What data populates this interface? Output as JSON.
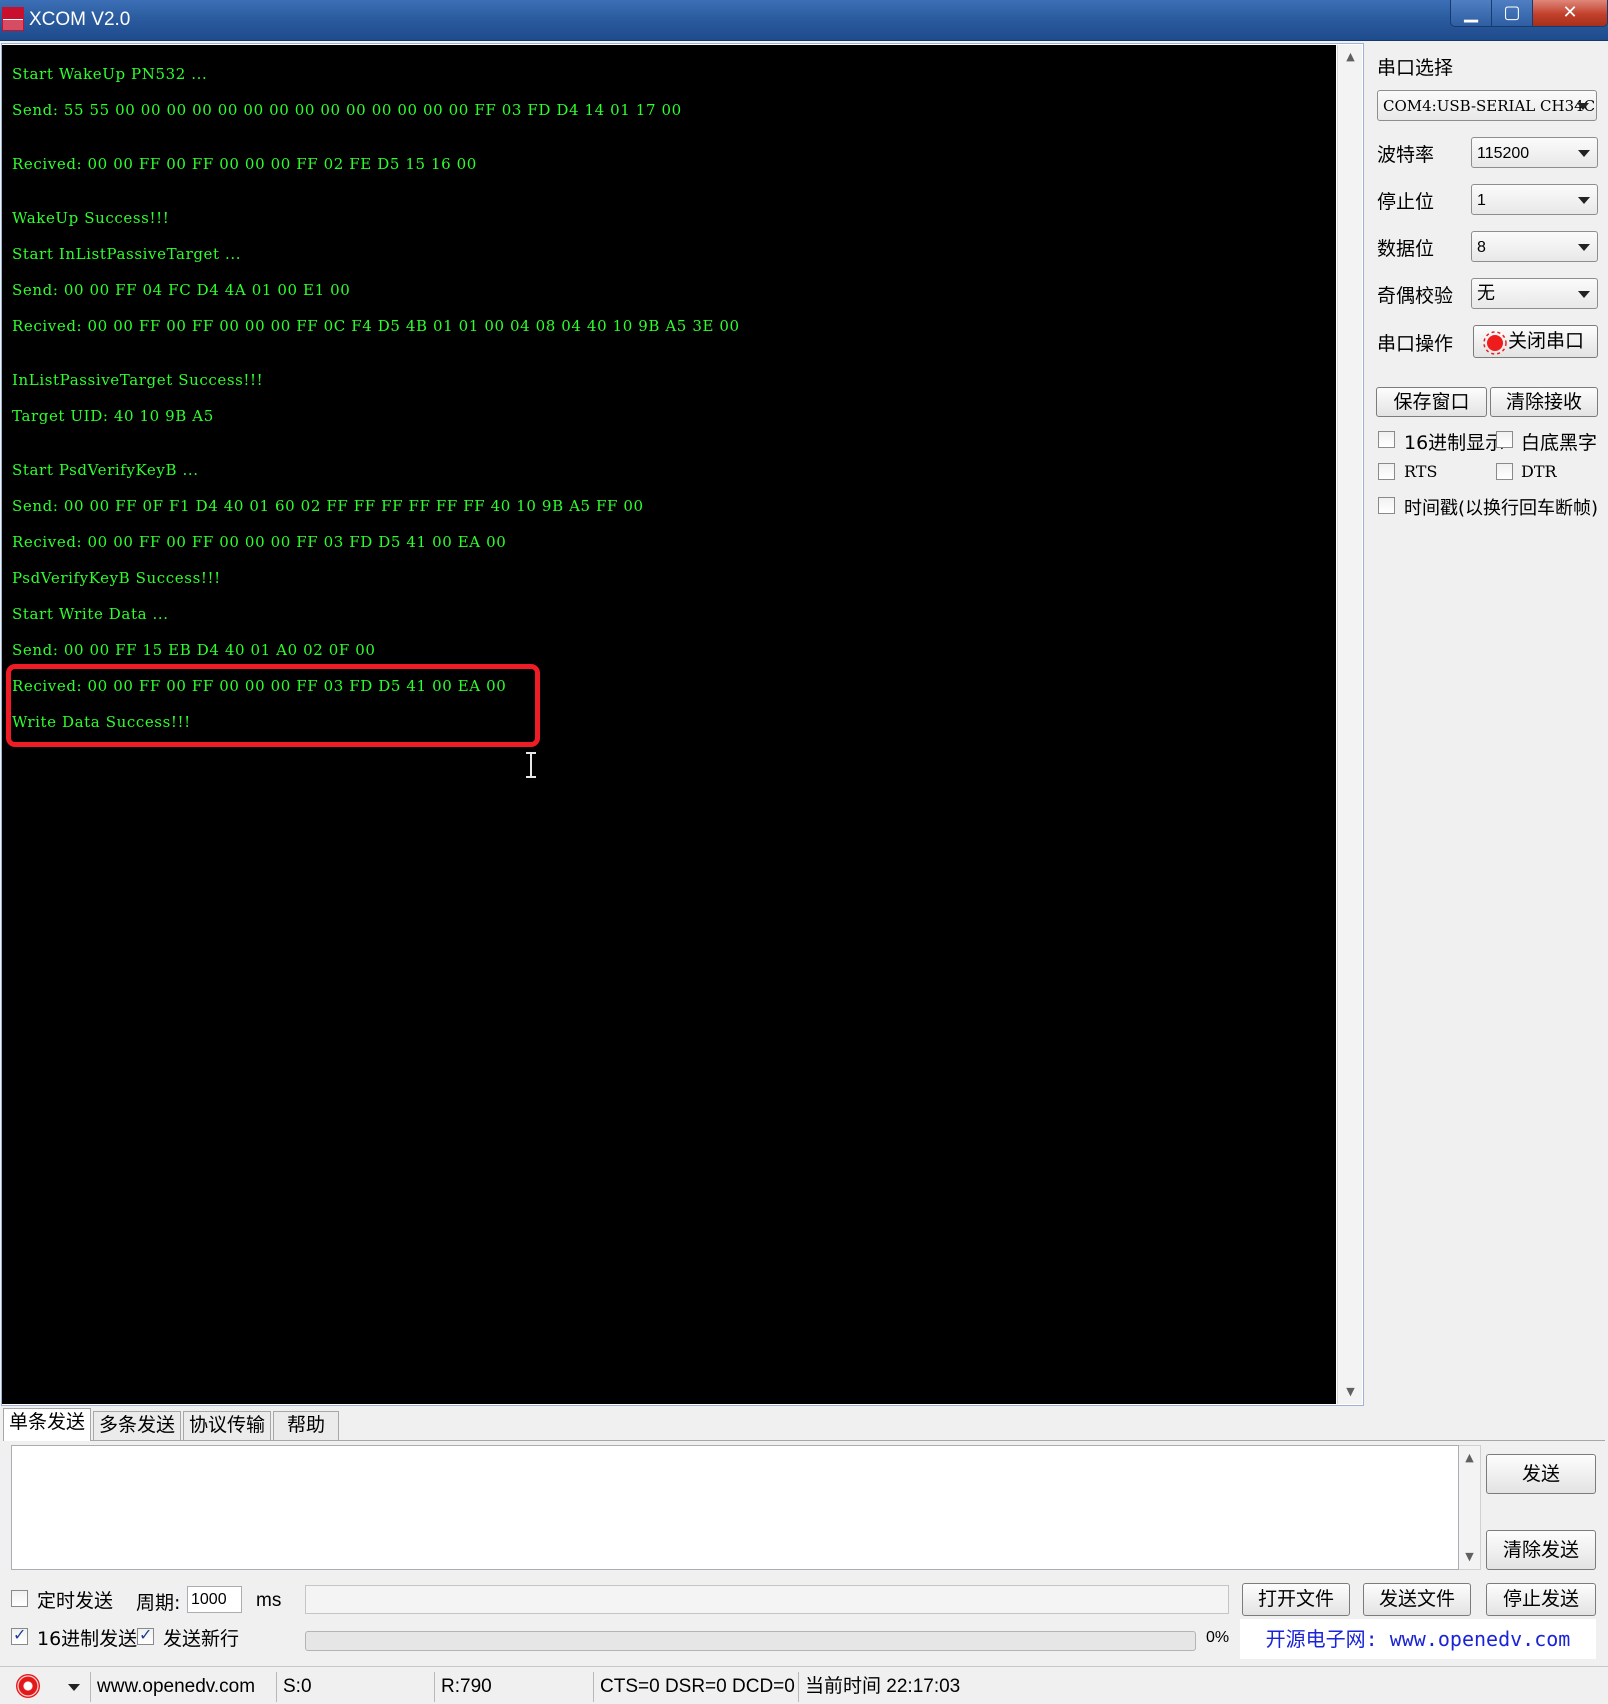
{
  "window": {
    "title": "XCOM V2.0",
    "min_glyph": "▁",
    "max_glyph": "▢",
    "close_glyph": "✕"
  },
  "receive": {
    "lines": [
      "Start WakeUp PN532 ...",
      "Send: 55 55 00 00 00 00 00 00 00 00 00 00 00 00 00 00 FF 03 FD D4 14 01 17 00",
      "Recived: 00 00 FF 00 FF 00 00 00 FF 02 FE D5 15 16 00",
      "WakeUp Success!!!",
      "Start InListPassiveTarget ...",
      "Send: 00 00 FF 04 FC D4 4A 01 00 E1 00",
      "Recived: 00 00 FF 00 FF 00 00 00 FF 0C F4 D5 4B 01 01 00 04 08 04 40 10 9B A5 3E 00",
      "InListPassiveTarget Success!!!",
      "Target UID: 40 10 9B A5",
      "Start PsdVerifyKeyB ...",
      "Send: 00 00 FF 0F F1 D4 40 01 60 02 FF FF FF FF FF FF 40 10 9B A5 FF 00",
      "Recived: 00 00 FF 00 FF 00 00 00 FF 03 FD D5 41 00 EA 00",
      "PsdVerifyKeyB Success!!!",
      "Start Write Data ...",
      "Send: 00 00 FF 15 EB D4 40 01 A0 02 0F 00",
      "Recived: 00 00 FF 00 FF 00 00 00 FF 03 FD D5 41 00 EA 00",
      "Write Data Success!!!"
    ],
    "text_color": "#2dff2d",
    "background": "#000000",
    "highlight_color": "#ee1c24"
  },
  "settings": {
    "port_label": "串口选择",
    "port_value": "COM4:USB-SERIAL CH34C",
    "baud_label": "波特率",
    "baud_value": "115200",
    "stopbits_label": "停止位",
    "stopbits_value": "1",
    "databits_label": "数据位",
    "databits_value": "8",
    "parity_label": "奇偶校验",
    "parity_value": "无",
    "op_label": "串口操作",
    "op_button": "关闭串口",
    "save_window": "保存窗口",
    "clear_receive": "清除接收",
    "hex_display": "16进制显示",
    "white_bg": "白底黑字",
    "rts": "RTS",
    "dtr": "DTR",
    "timestamp": "时间戳(以换行回车断帧)"
  },
  "tabs": [
    "单条发送",
    "多条发送",
    "协议传输",
    "帮助"
  ],
  "send": {
    "send_button": "发送",
    "clear_send": "清除发送",
    "timed_send": "定时发送",
    "period_label": "周期:",
    "period_value": "1000",
    "period_unit": "ms",
    "open_file": "打开文件",
    "send_file": "发送文件",
    "stop_send": "停止发送",
    "hex_send": "16进制发送",
    "send_newline": "发送新行",
    "progress_percent": 0,
    "progress_label": "0%",
    "promo": "开源电子网: www.openedv.com"
  },
  "status": {
    "website": "www.openedv.com",
    "sent": "S:0",
    "received": "R:790",
    "signals": "CTS=0 DSR=0 DCD=0",
    "time": "当前时间 22:17:03"
  }
}
